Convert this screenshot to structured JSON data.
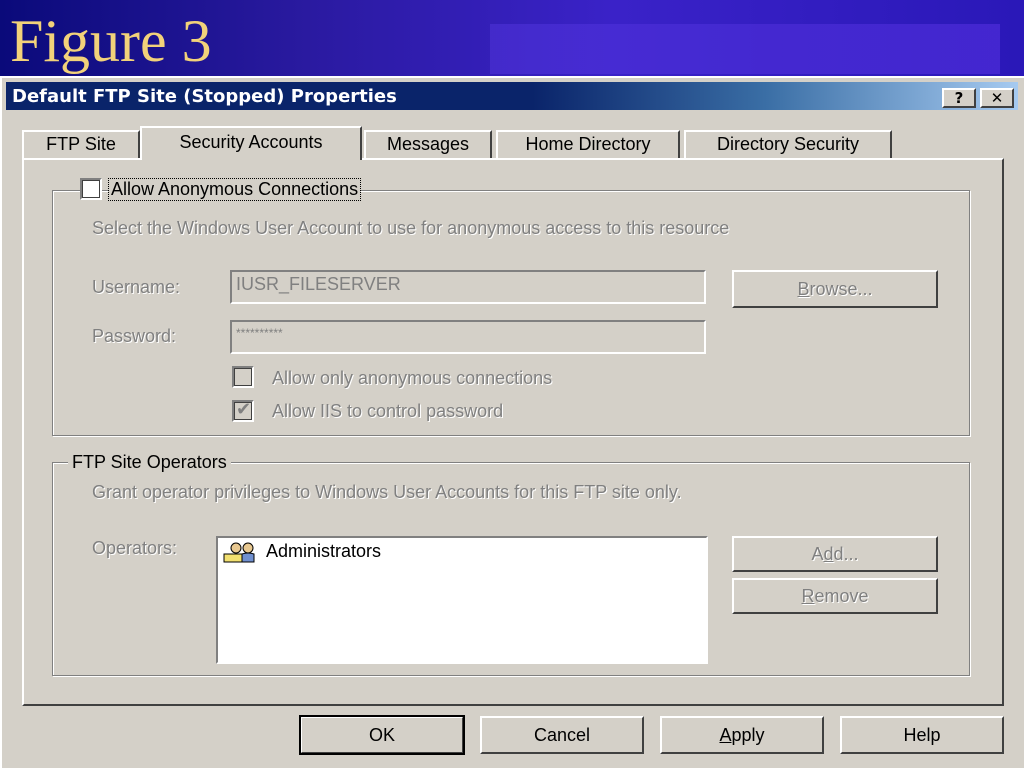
{
  "slide": {
    "title": "Figure 3"
  },
  "window": {
    "title": "Default FTP Site (Stopped) Properties",
    "help_button": "?",
    "close_button": "✕"
  },
  "tabs": [
    {
      "label": "FTP Site"
    },
    {
      "label": "Security Accounts"
    },
    {
      "label": "Messages"
    },
    {
      "label": "Home Directory"
    },
    {
      "label": "Directory Security"
    }
  ],
  "anonymous": {
    "checkbox_label": "Allow Anonymous Connections",
    "checked": false,
    "description": "Select the Windows User Account to use for anonymous access to this resource",
    "username_label": "Username:",
    "username_value": "IUSR_FILESERVER",
    "password_label": "Password:",
    "password_value": "**********",
    "browse_label": "Browse...",
    "anon_only_label": "Allow only anonymous connections",
    "anon_only_checked": false,
    "iis_control_label": "Allow IIS to control password",
    "iis_control_checked": true
  },
  "operators": {
    "group_label": "FTP Site Operators",
    "description": "Grant operator privileges to Windows User Accounts for this FTP site only.",
    "operators_label": "Operators:",
    "items": [
      "Administrators"
    ],
    "add_label": "Add...",
    "remove_label": "Remove"
  },
  "footer": {
    "ok_label": "OK",
    "cancel_label": "Cancel",
    "apply_label": "Apply",
    "help_label": "Help"
  }
}
